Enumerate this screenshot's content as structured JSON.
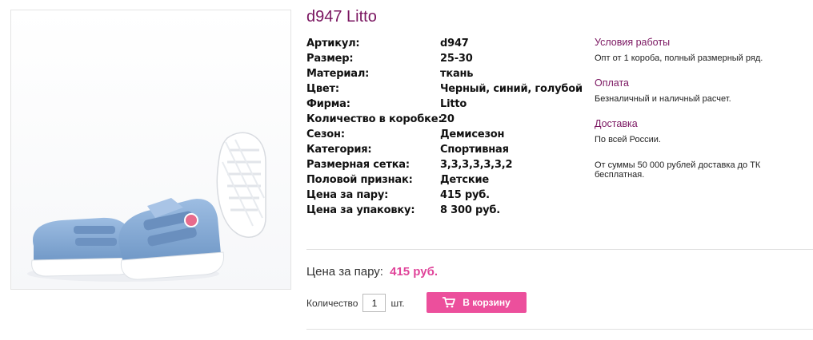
{
  "product": {
    "title": "d947 Litto",
    "image_alt": "Blue canvas sneakers with velcro straps"
  },
  "specs": [
    {
      "key": "Артикул:",
      "value": "d947"
    },
    {
      "key": "Размер:",
      "value": "25-30"
    },
    {
      "key": "Материал:",
      "value": "ткань"
    },
    {
      "key": "Цвет:",
      "value": "Черный, синий, голубой"
    },
    {
      "key": "Фирма:",
      "value": "Litto"
    },
    {
      "key": "Количество в коробке:",
      "value": "20"
    },
    {
      "key": "Сезон:",
      "value": "Демисезон"
    },
    {
      "key": "Категория:",
      "value": "Спортивная"
    },
    {
      "key": "Размерная сетка:",
      "value": "3,3,3,3,3,3,2"
    },
    {
      "key": "Половой признак:",
      "value": "Детские"
    },
    {
      "key": "Цена за пару:",
      "value": "415 руб."
    },
    {
      "key": "Цена за упаковку:",
      "value": "8 300 руб."
    }
  ],
  "info": {
    "terms": {
      "title": "Условия работы",
      "text": "Опт от 1 короба, полный размерный ряд."
    },
    "payment": {
      "title": "Оплата",
      "text": "Безналичный и наличный расчет."
    },
    "delivery": {
      "title": "Доставка",
      "text": "По всей России.",
      "extra": "От суммы 50 000 рублей доставка до ТК бесплатная."
    }
  },
  "purchase": {
    "price_label": "Цена за пару:",
    "price_value": "415 руб.",
    "qty_label": "Количество",
    "qty_value": "1",
    "qty_unit": "шт.",
    "cart_button": "В корзину"
  },
  "colors": {
    "accent": "#7a1560",
    "button": "#ec4f9c",
    "price": "#e0449a",
    "shoe": "#7fa6d4"
  },
  "icons": {
    "cart": "cart-icon"
  }
}
